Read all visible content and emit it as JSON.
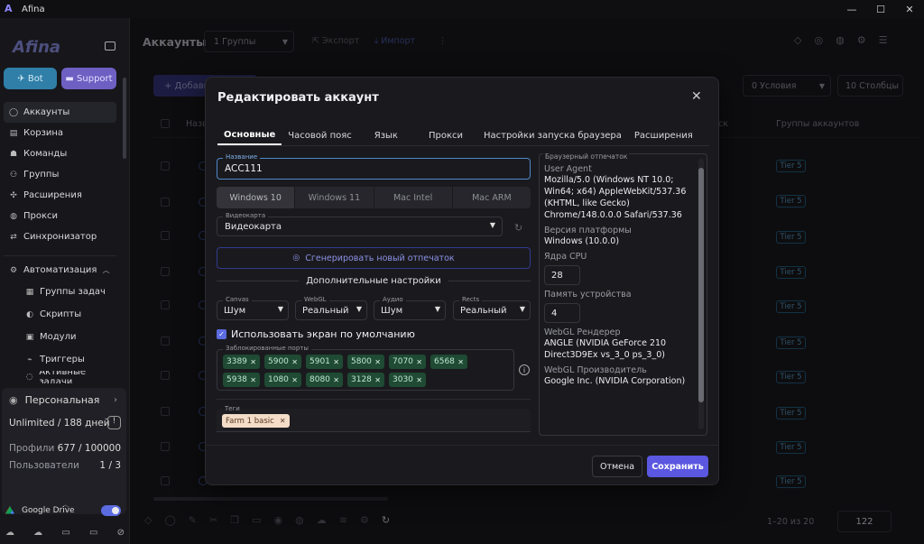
{
  "window": {
    "title": "Afina",
    "controls": [
      "—",
      "☐",
      "✕"
    ]
  },
  "sidebar": {
    "brand": "Afina",
    "bot_label": "Bot",
    "support_label": "Support",
    "nav": [
      {
        "label": "Аккаунты",
        "icon": "user-icon"
      },
      {
        "label": "Корзина",
        "icon": "trash-icon"
      },
      {
        "label": "Команды",
        "icon": "team-icon"
      },
      {
        "label": "Группы",
        "icon": "group-icon"
      },
      {
        "label": "Расширения",
        "icon": "puzzle-icon"
      },
      {
        "label": "Прокси",
        "icon": "globe-icon"
      },
      {
        "label": "Синхронизатор",
        "icon": "sync-icon"
      }
    ],
    "automation": {
      "label": "Автоматизация",
      "items": [
        "Группы задач",
        "Скрипты",
        "Модули",
        "Триггеры",
        "Активные задачи"
      ]
    },
    "plan": {
      "title": "Персональная",
      "unlimited": "Unlimited / 188 дней",
      "profiles_label": "Профили",
      "profiles_value": "677 / 100000",
      "users_label": "Пользователи",
      "users_value": "1 / 3"
    },
    "gdrive_label": "Google Drive"
  },
  "main": {
    "title": "Аккаунты",
    "groups_select": "1  Группы",
    "export_label": "Экспорт",
    "import_label": "Импорт",
    "add_label": "+  Добавить",
    "conditions_select": "0  Условия",
    "columns_btn": "10  Столбцы",
    "col_name": "Назв",
    "col_last": "ск",
    "col_groups": "Группы аккаунтов",
    "tier_label": "Tier 5",
    "pager_text": "1–20 из 20",
    "pager_value": "122"
  },
  "modal": {
    "title": "Редактировать аккаунт",
    "tabs": [
      "Основные",
      "Часовой пояс",
      "Язык",
      "Прокси",
      "Настройки запуска браузера",
      "Расширения"
    ],
    "name_label": "Название",
    "name_value": "ACC111",
    "os_options": [
      "Windows 10",
      "Windows 11",
      "Mac Intel",
      "Mac ARM"
    ],
    "gpu_label": "Видеокарта",
    "gpu_value": "Видеокарта",
    "generate_label": "Сгенерировать новый отпечаток",
    "advanced_title": "Дополнительные настройки",
    "canvas_label": "Canvas",
    "canvas_value": "Шум",
    "webgl_label": "WebGL",
    "webgl_value": "Реальный",
    "audio_label": "Аудио",
    "audio_value": "Шум",
    "rects_label": "Rects",
    "rects_value": "Реальный",
    "default_screen_label": "Использовать экран по умолчанию",
    "blocked_ports_label": "Заблокированные порты",
    "blocked_ports": [
      "3389",
      "5900",
      "5901",
      "5800",
      "7070",
      "6568",
      "5938",
      "1080",
      "8080",
      "3128",
      "3030"
    ],
    "tags_label": "Теги",
    "tags": [
      "Farm 1 basic"
    ],
    "fingerprint": {
      "legend": "Браузерный отпечаток",
      "user_agent_label": "User Agent",
      "user_agent_value": "Mozilla/5.0 (Windows NT 10.0; Win64; x64) AppleWebKit/537.36 (KHTML, like Gecko) Chrome/148.0.0.0 Safari/537.36",
      "platform_label": "Версия платформы",
      "platform_value": "Windows (10.0.0)",
      "cpu_label": "Ядра CPU",
      "cpu_value": "28",
      "memory_label": "Память устройства",
      "memory_value": "4",
      "renderer_label": "WebGL Рендерер",
      "renderer_value": "ANGLE (NVIDIA GeForce 210 Direct3D9Ex vs_3_0 ps_3_0)",
      "vendor_label": "WebGL Производитель",
      "vendor_value": "Google Inc. (NVIDIA Corporation)"
    },
    "cancel_label": "Отмена",
    "save_label": "Сохранить"
  }
}
